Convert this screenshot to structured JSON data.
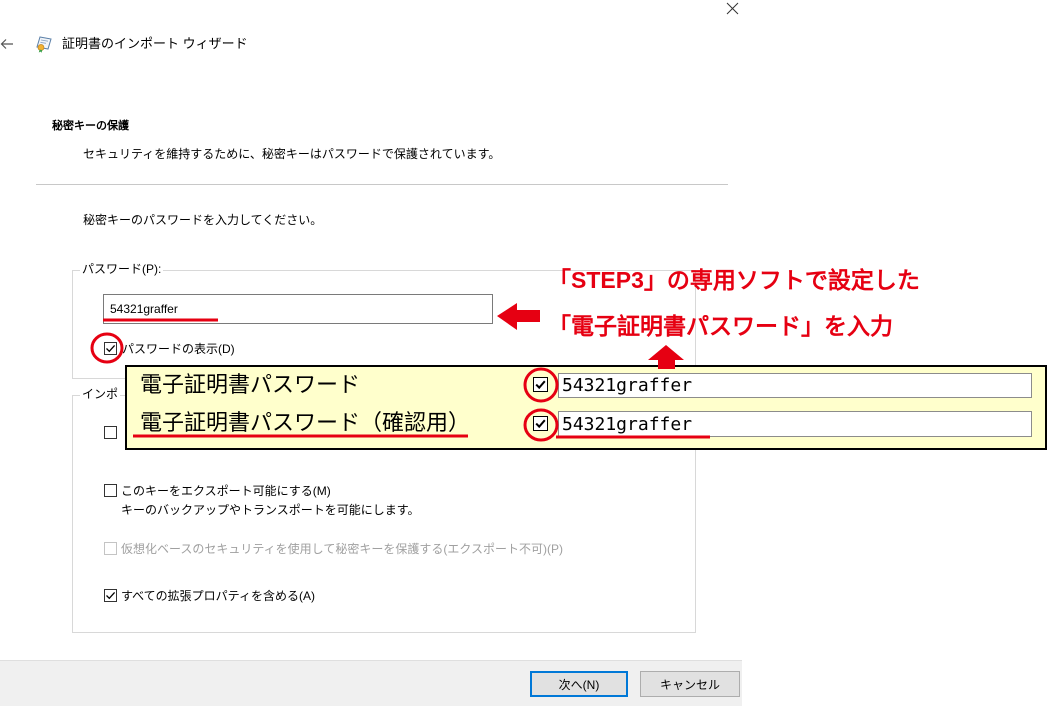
{
  "window": {
    "title": "証明書のインポート ウィザード",
    "icons": {
      "back": "back-arrow-icon",
      "app": "certificate-icon",
      "close": "close-icon"
    }
  },
  "page": {
    "heading": "秘密キーの保護",
    "subtitle": "セキュリティを維持するために、秘密キーはパスワードで保護されています。",
    "instruction": "秘密キーのパスワードを入力してください。"
  },
  "password_group": {
    "label": "パスワード(P):",
    "password_value": "54321graffer",
    "show_password": {
      "label": "パスワードの表示(D)",
      "checked": true
    }
  },
  "import_options": {
    "label": "インポ",
    "options": [
      {
        "checked": false,
        "enabled": true
      },
      {
        "label": "このキーをエクスポート可能にする(M)",
        "description": "キーのバックアップやトランスポートを可能にします。",
        "checked": false,
        "enabled": true
      },
      {
        "label": "仮想化ベースのセキュリティを使用して秘密キーを保護する(エクスポート不可)(P)",
        "checked": false,
        "enabled": false
      },
      {
        "label": "すべての拡張プロパティを含める(A)",
        "checked": true,
        "enabled": true
      }
    ]
  },
  "footer": {
    "next_label": "次へ(N)",
    "cancel_label": "キャンセル"
  },
  "annotation": {
    "callout_line1": "「STEP3」の専用ソフトで設定した",
    "callout_line2": "「電子証明書パスワード」を入力",
    "inset_rows": [
      {
        "label": "電子証明書パスワード",
        "value": "54321graffer",
        "checked": true
      },
      {
        "label": "電子証明書パスワード（確認用）",
        "value": "54321graffer",
        "checked": true
      }
    ]
  },
  "colors": {
    "annotation_red": "#e60012",
    "inset_background": "#ffffcc",
    "focus_blue": "#0078d7",
    "disabled_text": "#a0a0a0"
  }
}
